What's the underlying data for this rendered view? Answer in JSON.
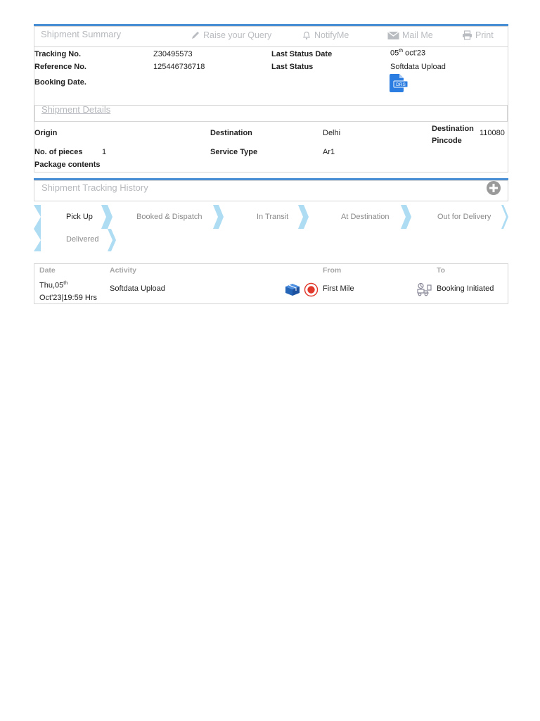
{
  "summary": {
    "title": "Shipment Summary",
    "actions": {
      "raise_query": "Raise your Query",
      "notify": "NotifyMe",
      "mail": "Mail Me",
      "print": "Print"
    },
    "tracking_no_label": "Tracking No.",
    "tracking_no": "Z30495573",
    "reference_no_label": "Reference No.",
    "reference_no": "125446736718",
    "booking_date_label": "Booking Date.",
    "last_status_date_label": "Last Status Date",
    "last_status_date_day": "05",
    "last_status_date_suffix": "th",
    "last_status_date_rest": " oct'23",
    "last_status_label": "Last Status",
    "last_status": "Softdata Upload",
    "drs_badge": "DRS"
  },
  "details": {
    "title": "Shipment Details",
    "origin_label": "Origin",
    "destination_label": "Destination",
    "destination": "Delhi",
    "dest_pincode_label_1": "Destination",
    "dest_pincode_label_2": "Pincode",
    "dest_pincode": "110080",
    "pieces_label": "No. of pieces",
    "pieces": "1",
    "service_type_label": "Service Type",
    "service_type": "Ar1",
    "package_contents_label": "Package contents"
  },
  "history": {
    "title": "Shipment Tracking History",
    "steps": [
      "Pick Up",
      "Booked & Dispatch",
      "In Transit",
      "At Destination",
      "Out for Delivery",
      "Delivered"
    ],
    "columns": {
      "date": "Date",
      "activity": "Activity",
      "from": "From",
      "to": "To"
    },
    "row": {
      "date_line1_prefix": "Thu,05",
      "date_line1_suffix": "th",
      "date_line2": "Oct'23|19:59 Hrs",
      "activity": "Softdata Upload",
      "from": "First Mile",
      "to": "Booking Initiated"
    }
  },
  "colors": {
    "accent": "#4a8fd4",
    "chevron": "#aedcf3",
    "record": "#e0382b",
    "box": "#2565b8"
  }
}
